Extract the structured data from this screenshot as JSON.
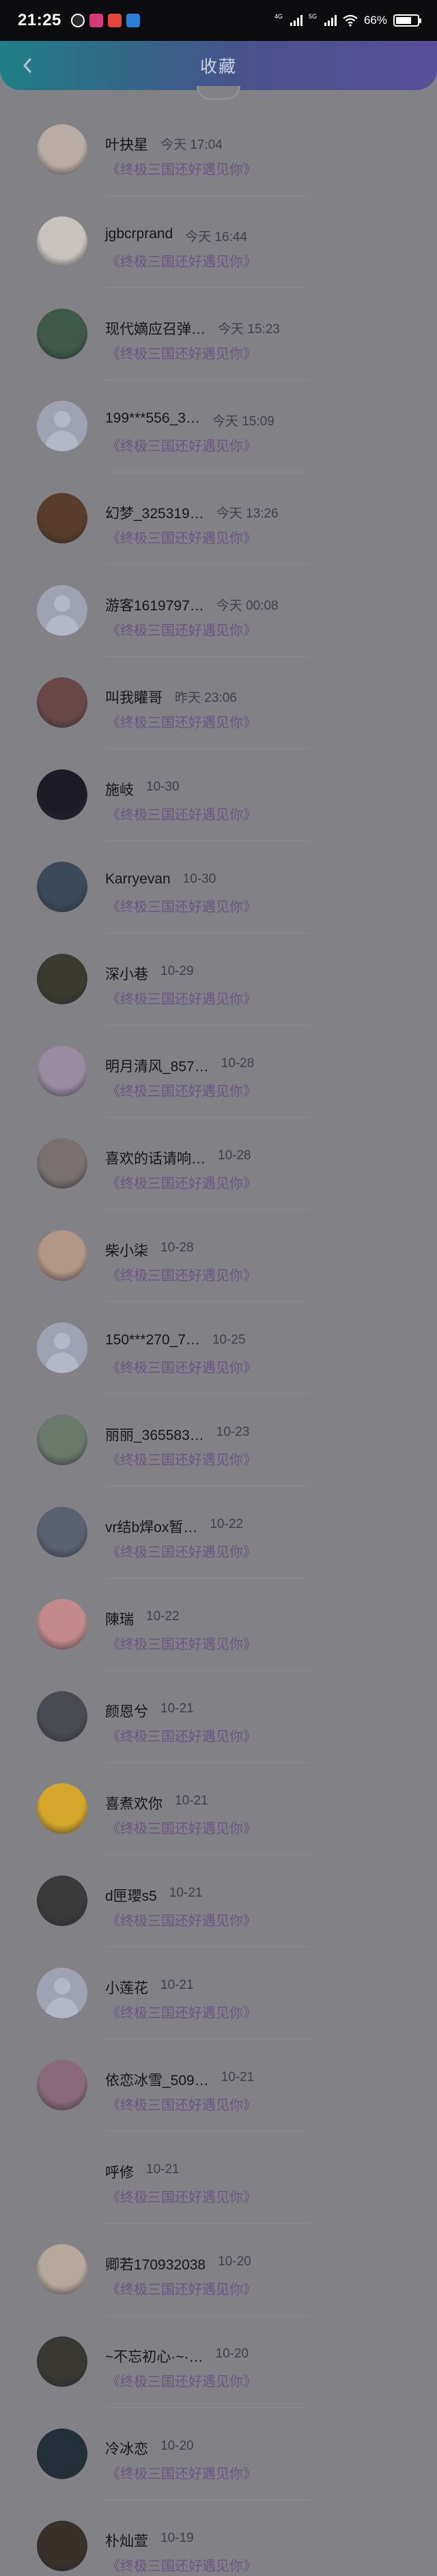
{
  "status_bar": {
    "time": "21:25",
    "network_1": "4G",
    "network_2": "5G",
    "battery": "66%"
  },
  "header": {
    "title": "收藏"
  },
  "items": [
    {
      "name": "叶抉星",
      "time": "今天 17:04",
      "subtitle": "《终极三国还好遇见你》",
      "avatar": "a1"
    },
    {
      "name": "jgbcrprand",
      "time": "今天 16:44",
      "subtitle": "《终极三国还好遇见你》",
      "avatar": "a2"
    },
    {
      "name": "现代嫡应召弹…",
      "time": "今天 15:23",
      "subtitle": "《终极三国还好遇见你》",
      "avatar": "a3"
    },
    {
      "name": "199***556_3…",
      "time": "今天 15:09",
      "subtitle": "《终极三国还好遇见你》",
      "avatar": "default"
    },
    {
      "name": "幻梦_325319…",
      "time": "今天 13:26",
      "subtitle": "《终极三国还好遇见你》",
      "avatar": "a5"
    },
    {
      "name": "游客1619797…",
      "time": "今天 00:08",
      "subtitle": "《终极三国还好遇见你》",
      "avatar": "default"
    },
    {
      "name": "叫我矔哥",
      "time": "昨天 23:06",
      "subtitle": "《终极三国还好遇见你》",
      "avatar": "a7"
    },
    {
      "name": "施岐",
      "time": "10-30",
      "subtitle": "《终极三国还好遇见你》",
      "avatar": "a8"
    },
    {
      "name": "Karryevan",
      "time": "10-30",
      "subtitle": "《终极三国还好遇见你》",
      "avatar": "a9"
    },
    {
      "name": "深小巷",
      "time": "10-29",
      "subtitle": "《终极三国还好遇见你》",
      "avatar": "a10"
    },
    {
      "name": "明月清风_857…",
      "time": "10-28",
      "subtitle": "《终极三国还好遇见你》",
      "avatar": "a11"
    },
    {
      "name": "喜欢的话请响…",
      "time": "10-28",
      "subtitle": "《终极三国还好遇见你》",
      "avatar": "a12"
    },
    {
      "name": "柴小柒",
      "time": "10-28",
      "subtitle": "《终极三国还好遇见你》",
      "avatar": "a13"
    },
    {
      "name": "150***270_7…",
      "time": "10-25",
      "subtitle": "《终极三国还好遇见你》",
      "avatar": "default"
    },
    {
      "name": "丽丽_365583…",
      "time": "10-23",
      "subtitle": "《终极三国还好遇见你》",
      "avatar": "a15"
    },
    {
      "name": "vr结b焊ox暂…",
      "time": "10-22",
      "subtitle": "《终极三国还好遇见你》",
      "avatar": "a16"
    },
    {
      "name": "陳瑞",
      "time": "10-22",
      "subtitle": "《终极三国还好遇见你》",
      "avatar": "a17"
    },
    {
      "name": "颜恩兮",
      "time": "10-21",
      "subtitle": "《终极三国还好遇见你》",
      "avatar": "a18"
    },
    {
      "name": "喜煮欢你",
      "time": "10-21",
      "subtitle": "《终极三国还好遇见你》",
      "avatar": "a19"
    },
    {
      "name": "d匣瓔s5",
      "time": "10-21",
      "subtitle": "《终极三国还好遇见你》",
      "avatar": "a20"
    },
    {
      "name": "小莲花",
      "time": "10-21",
      "subtitle": "《终极三国还好遇见你》",
      "avatar": "default"
    },
    {
      "name": "依恋冰雪_509…",
      "time": "10-21",
      "subtitle": "《终极三国还好遇见你》",
      "avatar": "a22"
    },
    {
      "name": "呼修",
      "time": "10-21",
      "subtitle": "《终极三国还好遇见你》",
      "avatar": "none"
    },
    {
      "name": "卿若170932038",
      "time": "10-20",
      "subtitle": "《终极三国还好遇见你》",
      "avatar": "a24"
    },
    {
      "name": "~不忘初心·~·…",
      "time": "10-20",
      "subtitle": "《终极三国还好遇见你》",
      "avatar": "a25"
    },
    {
      "name": "冷冰恋",
      "time": "10-20",
      "subtitle": "《终极三国还好遇见你》",
      "avatar": "a26"
    },
    {
      "name": "朴灿萱",
      "time": "10-19",
      "subtitle": "《终极三国还好遇见你》",
      "avatar": "a27"
    }
  ],
  "avatar_colors": {
    "a1": "#b9aca4",
    "a2": "#c9c3be",
    "a3": "#3f5a48",
    "a5": "#5a3c2a",
    "a7": "#6a4848",
    "a8": "#1d1a28",
    "a9": "#3b4a5a",
    "a10": "#3a3a2e",
    "a11": "#9a8aa2",
    "a12": "#7a7070",
    "a13": "#b29686",
    "a15": "#6a7a6a",
    "a16": "#5a6272",
    "a17": "#c28a8a",
    "a18": "#4a4a52",
    "a19": "#d4a72a",
    "a20": "#3a3a3a",
    "a22": "#8a6a7a",
    "a24": "#b6a89a",
    "a25": "#3a3832",
    "a26": "#22303a",
    "a27": "#3a302a"
  }
}
